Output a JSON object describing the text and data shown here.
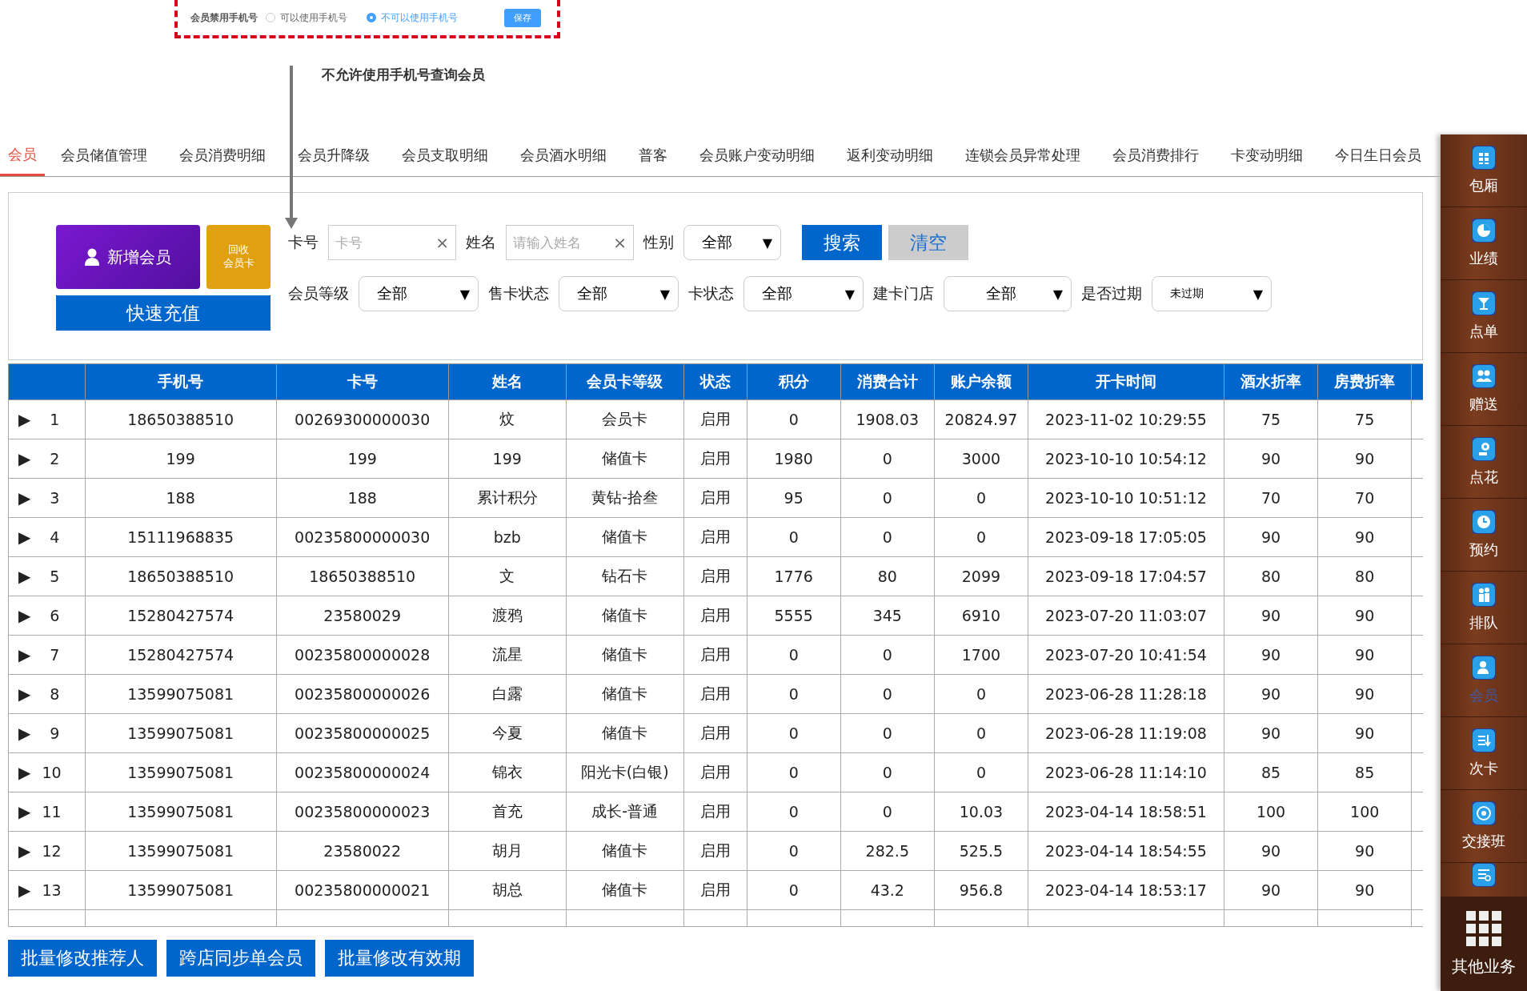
{
  "setting": {
    "label": "会员禁用手机号",
    "options": [
      {
        "label": "可以使用手机号",
        "selected": false
      },
      {
        "label": "不可以使用手机号",
        "selected": true
      }
    ],
    "save": "保存"
  },
  "annotation": "不允许使用手机号查询会员",
  "tabs": [
    {
      "label": "会员",
      "selected": true
    },
    {
      "label": "会员储值管理",
      "selected": false
    },
    {
      "label": "会员消费明细",
      "selected": false
    },
    {
      "label": "会员升降级",
      "selected": false
    },
    {
      "label": "会员支取明细",
      "selected": false
    },
    {
      "label": "会员酒水明细",
      "selected": false
    },
    {
      "label": "普客",
      "selected": false
    },
    {
      "label": "会员账户变动明细",
      "selected": false
    },
    {
      "label": "返利变动明细",
      "selected": false
    },
    {
      "label": "连锁会员异常处理",
      "selected": false
    },
    {
      "label": "会员消费排行",
      "selected": false
    },
    {
      "label": "卡变动明细",
      "selected": false
    },
    {
      "label": "今日生日会员",
      "selected": false
    }
  ],
  "actions": {
    "new_member": "新增会员",
    "recycle": [
      "回收",
      "会员卡"
    ],
    "recharge": "快速充值"
  },
  "filters_row1": [
    {
      "kind": "input",
      "label": "卡号",
      "placeholder": "卡号",
      "clear": "×"
    },
    {
      "kind": "input",
      "label": "姓名",
      "placeholder": "请输入姓名",
      "clear": "×"
    },
    {
      "kind": "select",
      "label": "性别",
      "value": "全部",
      "caret": "▼"
    }
  ],
  "search": "搜索",
  "clear": "清空",
  "filters_row2": [
    {
      "kind": "select",
      "label": "会员等级",
      "value": "全部",
      "caret": "▼"
    },
    {
      "kind": "select",
      "label": "售卡状态",
      "value": "全部",
      "caret": "▼"
    },
    {
      "kind": "select",
      "label": "卡状态",
      "value": "全部",
      "caret": "▼"
    },
    {
      "kind": "select",
      "label": "建卡门店",
      "value": "全部",
      "caret": "▼"
    },
    {
      "kind": "select",
      "label": "是否过期",
      "value": "未过期",
      "caret": "▼"
    }
  ],
  "table": {
    "columns": [
      "手机号",
      "卡号",
      "姓名",
      "会员卡等级",
      "状态",
      "积分",
      "消费合计",
      "账户余额",
      "开卡时间",
      "酒水折率",
      "房费折率"
    ],
    "rows": [
      {
        "expander": "▶",
        "index": "1",
        "cells": [
          "18650388510",
          "00269300000030",
          "炆",
          "会员卡",
          "启用",
          "0",
          "1908.03",
          "20824.97",
          "2023-11-02 10:29:55",
          "75",
          "75"
        ]
      },
      {
        "expander": "▶",
        "index": "2",
        "cells": [
          "199",
          "199",
          "199",
          "储值卡",
          "启用",
          "1980",
          "0",
          "3000",
          "2023-10-10 10:54:12",
          "90",
          "90"
        ]
      },
      {
        "expander": "▶",
        "index": "3",
        "cells": [
          "188",
          "188",
          "累计积分",
          "黄钻-拾叁",
          "启用",
          "95",
          "0",
          "0",
          "2023-10-10 10:51:12",
          "70",
          "70"
        ]
      },
      {
        "expander": "▶",
        "index": "4",
        "cells": [
          "15111968835",
          "00235800000030",
          "bzb",
          "储值卡",
          "启用",
          "0",
          "0",
          "0",
          "2023-09-18 17:05:05",
          "90",
          "90"
        ]
      },
      {
        "expander": "▶",
        "index": "5",
        "cells": [
          "18650388510",
          "18650388510",
          "文",
          "钻石卡",
          "启用",
          "1776",
          "80",
          "2099",
          "2023-09-18 17:04:57",
          "80",
          "80"
        ]
      },
      {
        "expander": "▶",
        "index": "6",
        "cells": [
          "15280427574",
          "23580029",
          "渡鸦",
          "储值卡",
          "启用",
          "5555",
          "345",
          "6910",
          "2023-07-20 11:03:07",
          "90",
          "90"
        ]
      },
      {
        "expander": "▶",
        "index": "7",
        "cells": [
          "15280427574",
          "00235800000028",
          "流星",
          "储值卡",
          "启用",
          "0",
          "0",
          "1700",
          "2023-07-20 10:41:54",
          "90",
          "90"
        ]
      },
      {
        "expander": "▶",
        "index": "8",
        "cells": [
          "13599075081",
          "00235800000026",
          "白露",
          "储值卡",
          "启用",
          "0",
          "0",
          "0",
          "2023-06-28 11:28:18",
          "90",
          "90"
        ]
      },
      {
        "expander": "▶",
        "index": "9",
        "cells": [
          "13599075081",
          "00235800000025",
          "今夏",
          "储值卡",
          "启用",
          "0",
          "0",
          "0",
          "2023-06-28 11:19:08",
          "90",
          "90"
        ]
      },
      {
        "expander": "▶",
        "index": "10",
        "cells": [
          "13599075081",
          "00235800000024",
          "锦衣",
          "阳光卡(白银)",
          "启用",
          "0",
          "0",
          "0",
          "2023-06-28 11:14:10",
          "85",
          "85"
        ]
      },
      {
        "expander": "▶",
        "index": "11",
        "cells": [
          "13599075081",
          "00235800000023",
          "首充",
          "成长-普通",
          "启用",
          "0",
          "0",
          "10.03",
          "2023-04-14 18:58:51",
          "100",
          "100"
        ]
      },
      {
        "expander": "▶",
        "index": "12",
        "cells": [
          "13599075081",
          "23580022",
          "胡月",
          "储值卡",
          "启用",
          "0",
          "282.5",
          "525.5",
          "2023-04-14 18:54:55",
          "90",
          "90"
        ]
      },
      {
        "expander": "▶",
        "index": "13",
        "cells": [
          "13599075081",
          "00235800000021",
          "胡总",
          "储值卡",
          "启用",
          "0",
          "43.2",
          "956.8",
          "2023-04-14 18:53:17",
          "90",
          "90"
        ]
      }
    ]
  },
  "bottom_buttons": [
    "批量修改推荐人",
    "跨店同步单会员",
    "批量修改有效期"
  ],
  "sidebar": {
    "items": [
      {
        "label": "包厢",
        "selected": false
      },
      {
        "label": "业绩",
        "selected": false
      },
      {
        "label": "点单",
        "selected": false
      },
      {
        "label": "赠送",
        "selected": false
      },
      {
        "label": "点花",
        "selected": false
      },
      {
        "label": "预约",
        "selected": false
      },
      {
        "label": "排队",
        "selected": false
      },
      {
        "label": "会员",
        "selected": true
      },
      {
        "label": "次卡",
        "selected": false
      },
      {
        "label": "交接班",
        "selected": false
      }
    ],
    "more": "其他业务"
  }
}
